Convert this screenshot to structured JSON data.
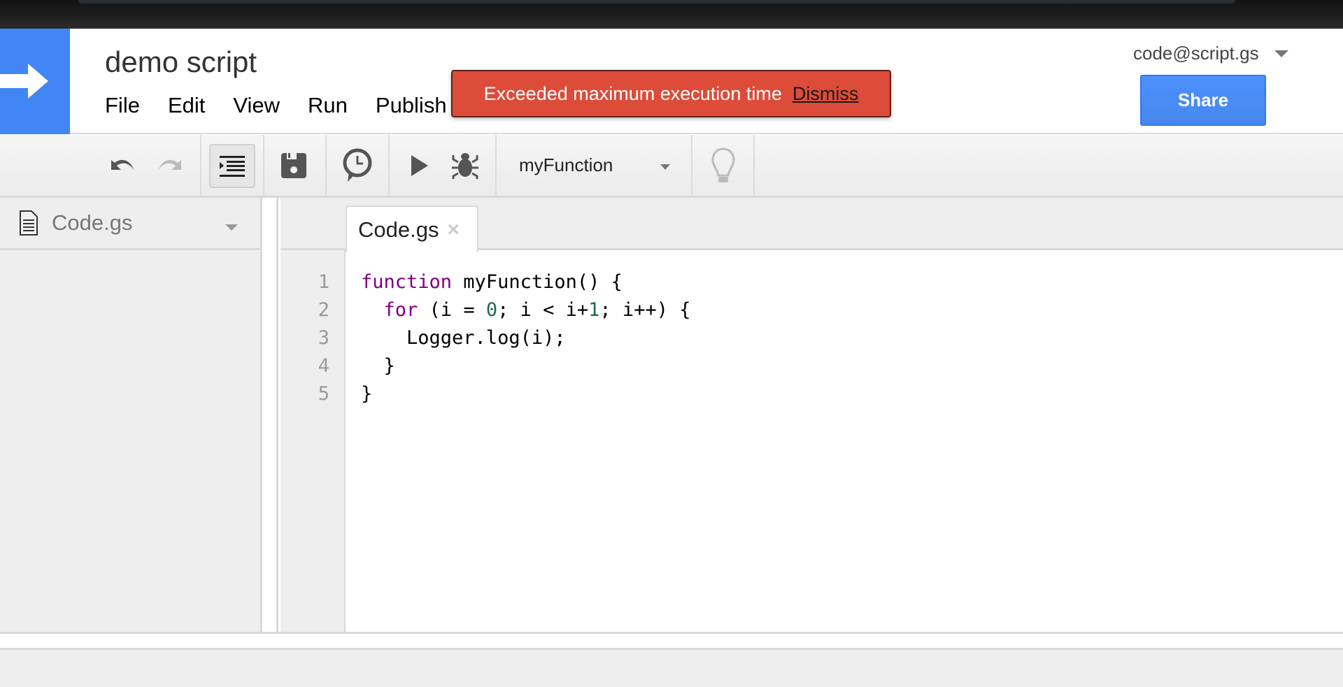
{
  "app": {
    "title": "demo script",
    "logo_icon": "apps-script-arrow-icon"
  },
  "menu": {
    "items": [
      {
        "label": "File"
      },
      {
        "label": "Edit"
      },
      {
        "label": "View"
      },
      {
        "label": "Run"
      },
      {
        "label": "Publish"
      }
    ]
  },
  "account": {
    "email": "code@script.gs",
    "caret_icon": "caret-down-icon"
  },
  "share": {
    "label": "Share"
  },
  "toast": {
    "message": "Exceeded maximum execution time",
    "dismiss_label": "Dismiss",
    "color": "#dd4b39"
  },
  "toolbar": {
    "undo_icon": "undo-icon",
    "redo_icon": "redo-icon",
    "indent_icon": "indent-icon",
    "save_icon": "save-icon",
    "triggers_icon": "clock-trigger-icon",
    "run_icon": "play-icon",
    "debug_icon": "bug-icon",
    "function_select": {
      "selected": "myFunction"
    },
    "bulb_icon": "lightbulb-icon"
  },
  "files": {
    "items": [
      {
        "name": "Code.gs",
        "icon": "document-icon"
      }
    ]
  },
  "editor": {
    "tabs": [
      {
        "label": "Code.gs",
        "close_label": "×"
      }
    ],
    "line_numbers": [
      "1",
      "2",
      "3",
      "4",
      "5"
    ],
    "lines": [
      {
        "tokens": [
          {
            "t": "function",
            "k": "kw"
          },
          {
            "t": " myFunction() {",
            "k": ""
          }
        ]
      },
      {
        "tokens": [
          {
            "t": "  ",
            "k": ""
          },
          {
            "t": "for",
            "k": "kw"
          },
          {
            "t": " (i = ",
            "k": ""
          },
          {
            "t": "0",
            "k": "num"
          },
          {
            "t": "; i < i+",
            "k": ""
          },
          {
            "t": "1",
            "k": "num"
          },
          {
            "t": "; i++) {",
            "k": ""
          }
        ]
      },
      {
        "tokens": [
          {
            "t": "    Logger.log(i);",
            "k": ""
          }
        ]
      },
      {
        "tokens": [
          {
            "t": "  }",
            "k": ""
          }
        ]
      },
      {
        "tokens": [
          {
            "t": "}",
            "k": ""
          }
        ]
      }
    ]
  },
  "colors": {
    "brand_blue": "#4285f4",
    "share_blue": "#4d90fe",
    "keyword": "#7f0080",
    "number": "#1a6b4a"
  }
}
